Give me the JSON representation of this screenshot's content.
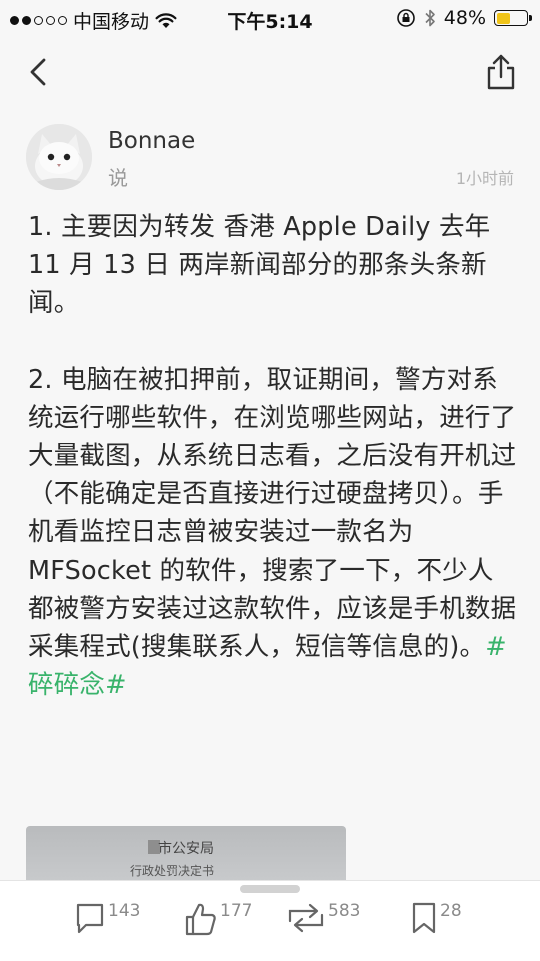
{
  "status_bar": {
    "carrier": "中国移动",
    "time": "下午5:14",
    "battery": "48%",
    "battery_level": 0.48,
    "accent_color": "#f0c419"
  },
  "post": {
    "author": "Bonnae",
    "verb": "说",
    "time_ago": "1小时前",
    "paragraph1": "1. 主要因为转发 香港 Apple Daily 去年 11 月 13 日 两岸新闻部分的那条头条新闻。",
    "paragraph2_text": "2. 电脑在被扣押前，取证期间，警方对系统运行哪些软件，在浏览哪些网站，进行了大量截图，从系统日志看，之后没有开机过（不能确定是否直接进行过硬盘拷贝）。手机看监控日志曾被安装过一款名为 MFSocket 的软件，搜索了一下，不少人都被警方安装过这款软件，应该是手机数据采集程式(搜集联系人，短信等信息的)。",
    "hashtag": "#碎碎念#",
    "hashtag_color": "#39b36b",
    "image_title": "市公安局",
    "image_subtitle": "行政处罚决定书"
  },
  "toolbar": {
    "comments": "143",
    "likes": "177",
    "reposts": "583",
    "bookmarks": "28"
  },
  "icons": {
    "back": "chevron-left-icon",
    "share": "share-icon",
    "comment": "comment-icon",
    "like": "thumbs-up-icon",
    "repost": "repost-icon",
    "bookmark": "bookmark-icon"
  }
}
